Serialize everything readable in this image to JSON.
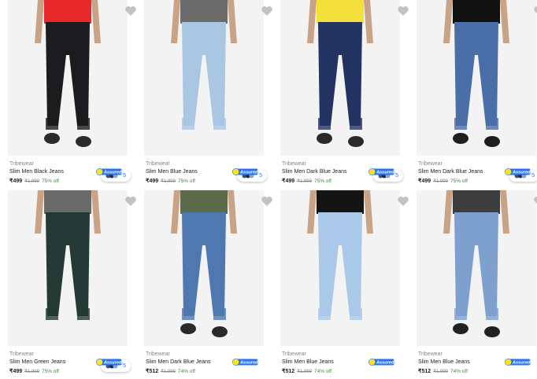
{
  "products": [
    {
      "brand": "Tribewear",
      "title": "Slim Men Black Jeans",
      "price": "₹499",
      "mrp": "₹1,999",
      "discount": "75% off",
      "swatch_count": "5",
      "shirt": "#e8282a",
      "jean": "#1c1c1e",
      "shoe": "#2a2a2a"
    },
    {
      "brand": "Tribewear",
      "title": "Slim Men Blue Jeans",
      "price": "₹499",
      "mrp": "₹1,999",
      "discount": "75% off",
      "swatch_count": "5",
      "shirt": "#6b6b6b",
      "jean": "#a9c6e3",
      "shoe": "#f2f2f2"
    },
    {
      "brand": "Tribewear",
      "title": "Slim Men Dark Blue Jeans",
      "price": "₹499",
      "mrp": "₹1,999",
      "discount": "75% off",
      "swatch_count": "5",
      "shirt": "#f4e03a",
      "jean": "#233463",
      "shoe": "#2a2a2a"
    },
    {
      "brand": "Tribewear",
      "title": "Slim Men Dark Blue Jeans",
      "price": "₹499",
      "mrp": "₹1,999",
      "discount": "75% off",
      "swatch_count": "5",
      "shirt": "#111111",
      "jean": "#4a6ea8",
      "shoe": "#1e1e1e"
    },
    {
      "brand": "Tribewear",
      "title": "Slim Men Green Jeans",
      "price": "₹499",
      "mrp": "₹1,999",
      "discount": "75% off",
      "swatch_count": "5",
      "shirt": "#6a6a6a",
      "jean": "#253a34",
      "shoe": "#f2f2f2"
    },
    {
      "brand": "Tribewear",
      "title": "Slim Men Dark Blue Jeans",
      "price": "₹512",
      "mrp": "₹1,999",
      "discount": "74% off",
      "swatch_count": "",
      "shirt": "#5b6b4a",
      "jean": "#4f77b0",
      "shoe": "#2a2a2a"
    },
    {
      "brand": "Tribewear",
      "title": "Slim Men Blue Jeans",
      "price": "₹512",
      "mrp": "₹1,999",
      "discount": "74% off",
      "swatch_count": "",
      "shirt": "#141414",
      "jean": "#aac8e8",
      "shoe": "#f2f2f2"
    },
    {
      "brand": "Tribewear",
      "title": "Slim Men Blue Jeans",
      "price": "₹512",
      "mrp": "₹1,999",
      "discount": "74% off",
      "swatch_count": "",
      "shirt": "#3d3d3d",
      "jean": "#7ea0cf",
      "shoe": "#222222"
    }
  ],
  "assured_label": "Assured",
  "colors": {
    "accent": "#2874f0",
    "discount": "#388e3c",
    "assured_yellow": "#ffe11b",
    "heart": "#c2c2c2"
  }
}
